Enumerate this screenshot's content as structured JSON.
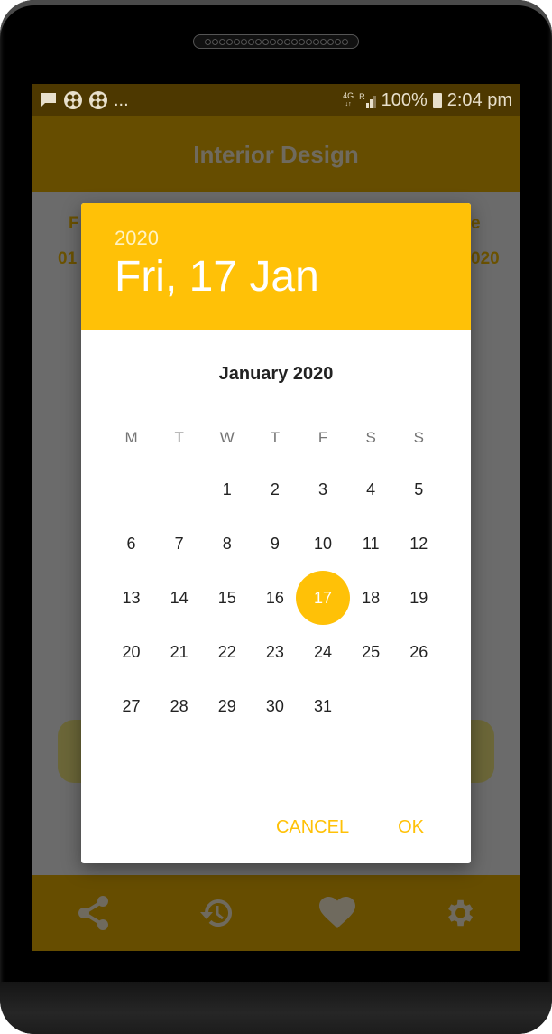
{
  "status_bar": {
    "left_icons": [
      "message-icon",
      "app-icon",
      "app-icon",
      "more-notifications-icon"
    ],
    "more_text": "...",
    "network": "4G",
    "roaming": "R",
    "battery": "100%",
    "time": "2:04 pm"
  },
  "app_bar": {
    "title": "Interior Design"
  },
  "background": {
    "left_label_1": "F",
    "left_label_2": "01",
    "right_label_1": "e",
    "right_label_2": "020"
  },
  "date_picker": {
    "header_year": "2020",
    "header_date": "Fri, 17 Jan",
    "month_title": "January 2020",
    "weekdays": [
      "M",
      "T",
      "W",
      "T",
      "F",
      "S",
      "S"
    ],
    "weeks": [
      [
        "",
        "",
        "1",
        "2",
        "3",
        "4",
        "5"
      ],
      [
        "6",
        "7",
        "8",
        "9",
        "10",
        "11",
        "12"
      ],
      [
        "13",
        "14",
        "15",
        "16",
        "17",
        "18",
        "19"
      ],
      [
        "20",
        "21",
        "22",
        "23",
        "24",
        "25",
        "26"
      ],
      [
        "27",
        "28",
        "29",
        "30",
        "31",
        "",
        ""
      ]
    ],
    "selected_day": "17",
    "cancel_label": "CANCEL",
    "ok_label": "OK"
  },
  "bottom_nav": [
    {
      "icon": "share-icon"
    },
    {
      "icon": "history-icon"
    },
    {
      "icon": "heart-icon"
    },
    {
      "icon": "settings-icon"
    }
  ],
  "colors": {
    "accent": "#ffc107",
    "app_bar_dimmed": "#664d00",
    "status_bar_dimmed": "#4d3800"
  }
}
